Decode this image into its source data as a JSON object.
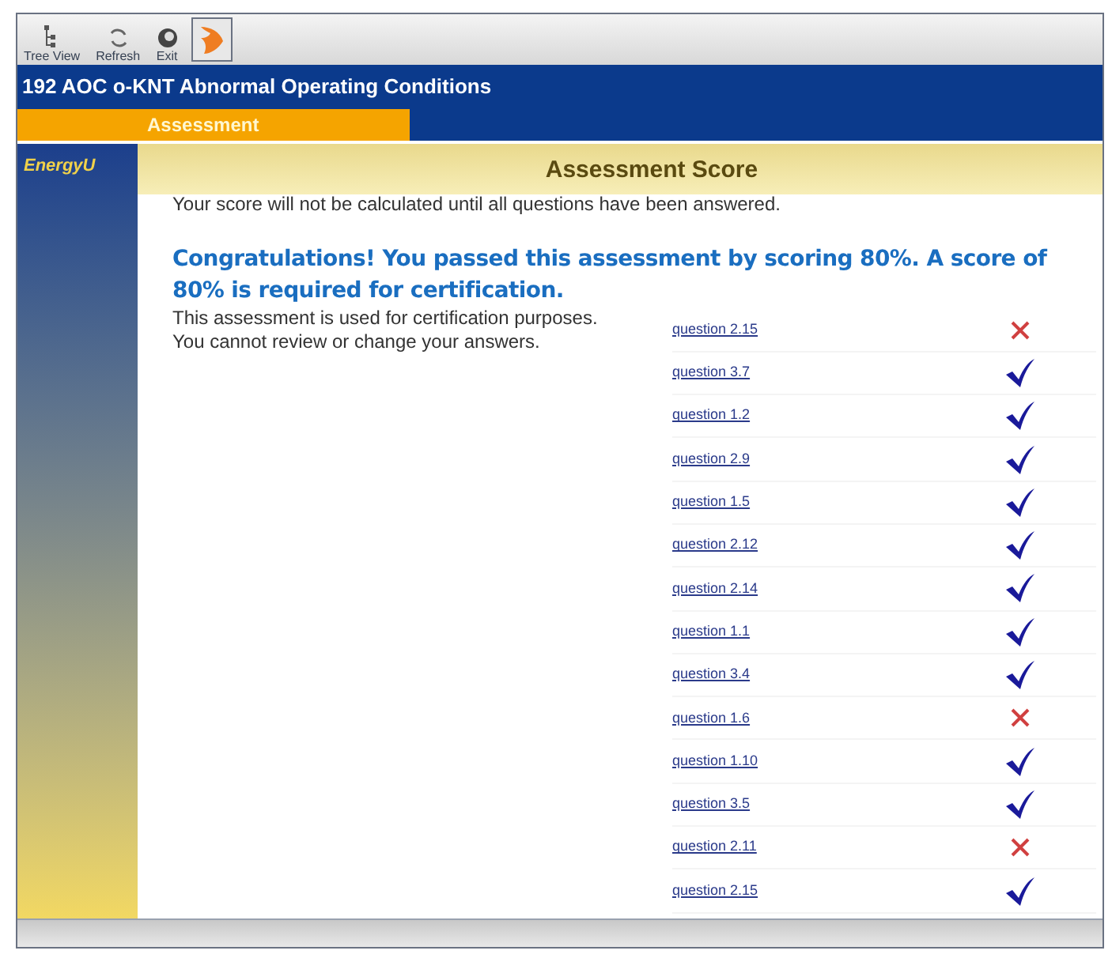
{
  "toolbar": [
    {
      "kind": "tree",
      "label": "Tree View"
    },
    {
      "kind": "refresh",
      "label": "Refresh"
    },
    {
      "kind": "exit",
      "label": "Exit"
    },
    {
      "kind": "logo",
      "selected": true
    }
  ],
  "course_title": "192 AOC o-KNT Abnormal Operating Conditions",
  "tabs": [
    {
      "label": "Assessment",
      "selected": true
    }
  ],
  "sidebar": {
    "brand": "EnergyU"
  },
  "page_title": "Assessment Score",
  "notice": "Your score will not be calculated until all questions have been answered.",
  "result": "Congratulations! You passed this assessment by scoring 80%. A score of 80% is required for certification.",
  "info": "This assessment is used for certification purposes. You cannot review or change your answers.",
  "questions": [
    {
      "label": "question 2.15",
      "correct": false
    },
    {
      "label": "question 3.7",
      "correct": true
    },
    {
      "label": "question 1.2",
      "correct": true
    },
    {
      "label": "question 2.9",
      "correct": true
    },
    {
      "label": "question 1.5",
      "correct": true
    },
    {
      "label": "question 2.12",
      "correct": true
    },
    {
      "label": "question 2.14",
      "correct": true
    },
    {
      "label": "question 1.1",
      "correct": true
    },
    {
      "label": "question 3.4",
      "correct": true
    },
    {
      "label": "question 1.6",
      "correct": false
    },
    {
      "label": "question 1.10",
      "correct": true
    },
    {
      "label": "question 3.5",
      "correct": true
    },
    {
      "label": "question 2.11",
      "correct": false
    },
    {
      "label": "question 2.15",
      "correct": true
    }
  ]
}
